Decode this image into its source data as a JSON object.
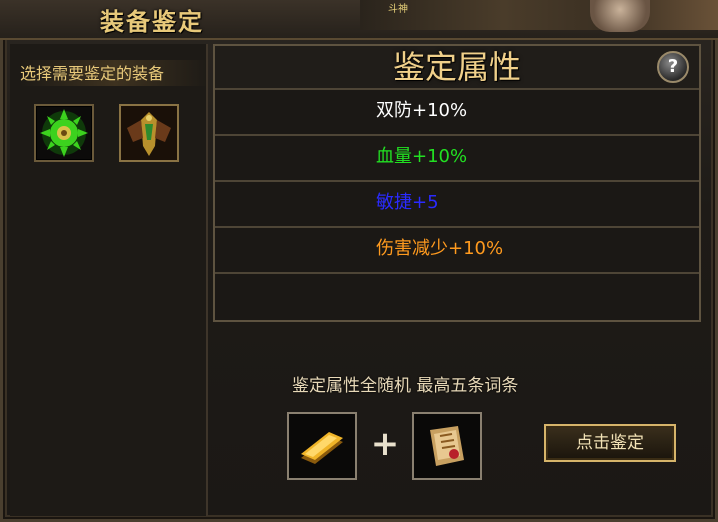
{
  "window": {
    "title": "装备鉴定"
  },
  "scene": {
    "tag": "斗神"
  },
  "left_panel": {
    "label": "选择需要鉴定的装备",
    "slots": [
      {
        "icon": "green-gear-item-icon"
      },
      {
        "icon": "winged-armor-item-icon"
      }
    ]
  },
  "attributes": {
    "title": "鉴定属性",
    "help_label": "?",
    "rows": [
      {
        "text": "双防+10%",
        "color": "#ffffff"
      },
      {
        "text": "血量+10%",
        "color": "#22e022"
      },
      {
        "text": "敏捷+5",
        "color": "#2a2aff"
      },
      {
        "text": "伤害减少+10%",
        "color": "#ff9a1e"
      },
      {
        "text": "",
        "color": "#ffffff"
      }
    ]
  },
  "bottom": {
    "tagline": "鉴定属性全随机  最高五条词条",
    "materials": [
      {
        "icon": "gold-bar-icon"
      },
      {
        "icon": "identify-scroll-icon"
      }
    ],
    "plus": "+",
    "button_label": "点击鉴定"
  },
  "colors": {
    "accent": "#e8c97a",
    "frame": "#5e5340"
  }
}
